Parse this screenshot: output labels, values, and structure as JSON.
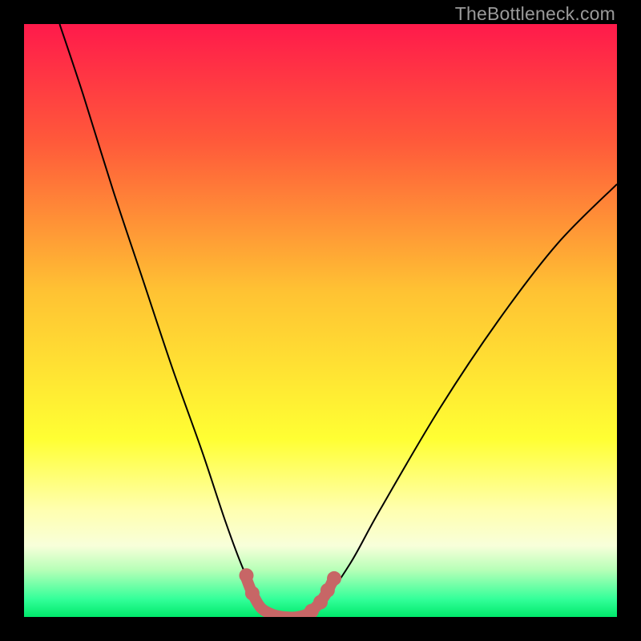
{
  "watermark": {
    "text": "TheBottleneck.com"
  },
  "chart_data": {
    "type": "line",
    "title": "",
    "xlabel": "",
    "ylabel": "",
    "xlim": [
      0,
      100
    ],
    "ylim": [
      0,
      100
    ],
    "gradient_stops": [
      {
        "offset": 0,
        "color": "#ff1a4b"
      },
      {
        "offset": 0.2,
        "color": "#ff5a3a"
      },
      {
        "offset": 0.45,
        "color": "#ffc233"
      },
      {
        "offset": 0.7,
        "color": "#ffff33"
      },
      {
        "offset": 0.82,
        "color": "#ffffb0"
      },
      {
        "offset": 0.88,
        "color": "#f8ffda"
      },
      {
        "offset": 0.92,
        "color": "#b8ffb8"
      },
      {
        "offset": 0.97,
        "color": "#33ff99"
      },
      {
        "offset": 1.0,
        "color": "#00e86b"
      }
    ],
    "series": [
      {
        "name": "bottleneck-curve",
        "stroke": "#000000",
        "stroke_width": 2,
        "points": [
          {
            "x": 6,
            "y": 100
          },
          {
            "x": 10,
            "y": 88
          },
          {
            "x": 15,
            "y": 72
          },
          {
            "x": 20,
            "y": 57
          },
          {
            "x": 25,
            "y": 42
          },
          {
            "x": 30,
            "y": 28
          },
          {
            "x": 34,
            "y": 16
          },
          {
            "x": 37,
            "y": 8
          },
          {
            "x": 40,
            "y": 2
          },
          {
            "x": 43,
            "y": 0
          },
          {
            "x": 47,
            "y": 0
          },
          {
            "x": 50,
            "y": 2
          },
          {
            "x": 55,
            "y": 9
          },
          {
            "x": 60,
            "y": 18
          },
          {
            "x": 70,
            "y": 35
          },
          {
            "x": 80,
            "y": 50
          },
          {
            "x": 90,
            "y": 63
          },
          {
            "x": 100,
            "y": 73
          }
        ]
      },
      {
        "name": "highlight-band",
        "stroke": "#c76666",
        "stroke_width": 14,
        "linecap": "round",
        "points": [
          {
            "x": 37.5,
            "y": 6.5
          },
          {
            "x": 38.5,
            "y": 4.0
          },
          {
            "x": 40.0,
            "y": 1.5
          },
          {
            "x": 42.0,
            "y": 0.4
          },
          {
            "x": 44.0,
            "y": 0.0
          },
          {
            "x": 46.0,
            "y": 0.0
          },
          {
            "x": 48.0,
            "y": 0.6
          },
          {
            "x": 49.5,
            "y": 2.0
          },
          {
            "x": 51.0,
            "y": 4.0
          },
          {
            "x": 52.0,
            "y": 6.0
          }
        ]
      }
    ],
    "markers": {
      "name": "highlight-dots",
      "fill": "#c76666",
      "radius": 9,
      "points": [
        {
          "x": 37.5,
          "y": 7.0
        },
        {
          "x": 38.5,
          "y": 4.0
        },
        {
          "x": 48.5,
          "y": 1.0
        },
        {
          "x": 50.0,
          "y": 2.5
        },
        {
          "x": 51.2,
          "y": 4.5
        },
        {
          "x": 52.3,
          "y": 6.5
        }
      ]
    }
  }
}
